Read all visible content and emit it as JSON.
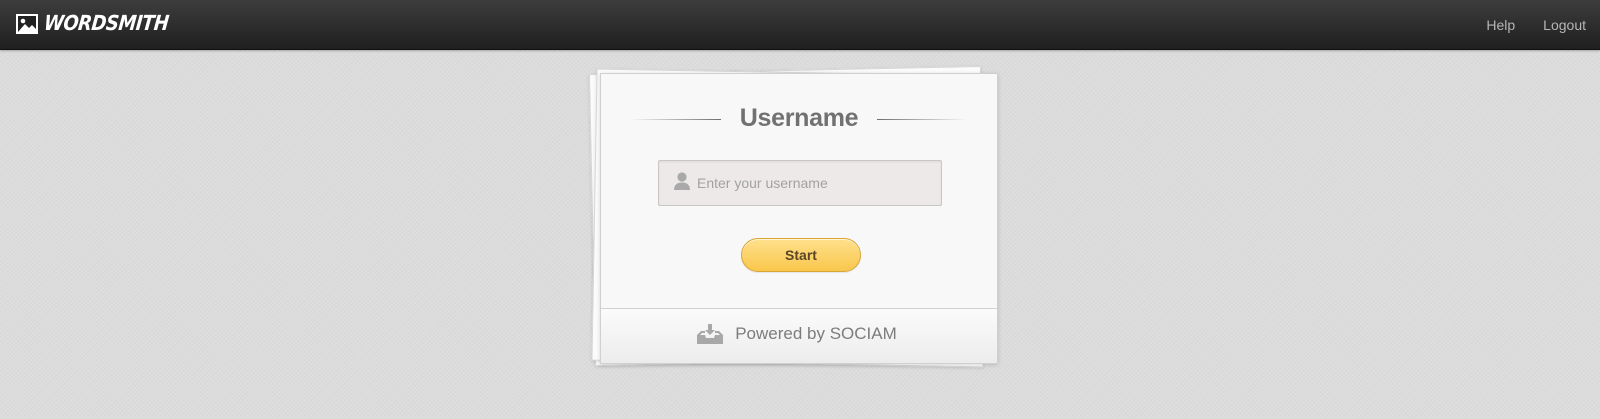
{
  "app": {
    "brand_name": "WORDSMITH",
    "brand_icon": "image-icon"
  },
  "nav": {
    "links": [
      {
        "label": "Help",
        "icon": null
      },
      {
        "label": "Logout",
        "icon": null
      }
    ]
  },
  "login": {
    "title": "Username",
    "input": {
      "value": "",
      "placeholder": "Enter your username",
      "icon": "user-icon"
    },
    "submit_label": "Start",
    "footer_text": "Powered by SOCIAM",
    "footer_icon": "inbox-download-icon"
  },
  "colors": {
    "navbar": "#2b2b2b",
    "background": "#dcdcdc",
    "button": "#fbd063",
    "title": "#717171"
  }
}
